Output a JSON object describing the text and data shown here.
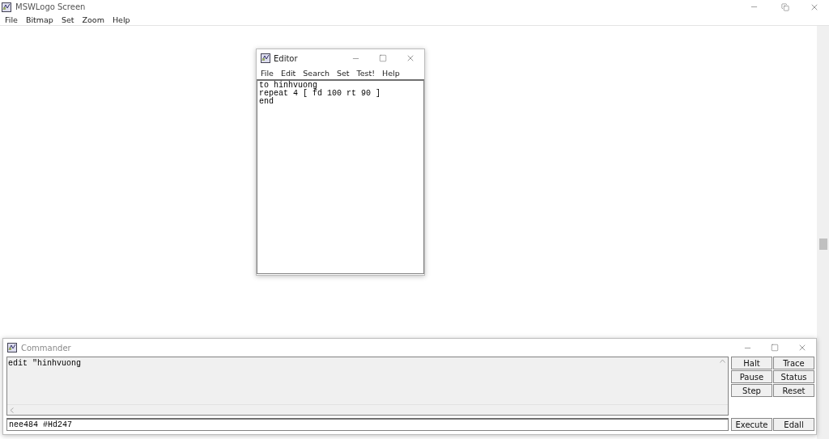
{
  "window": {
    "title": "MSWLogo Screen",
    "maximized": true
  },
  "menu": [
    "File",
    "Bitmap",
    "Set",
    "Zoom",
    "Help"
  ],
  "editor": {
    "title": "Editor",
    "menu": [
      "File",
      "Edit",
      "Search",
      "Set",
      "Test!",
      "Help"
    ],
    "lines": [
      "to hinhvuong",
      "repeat 4 [ fd 100 rt 90 ]",
      "end"
    ]
  },
  "commander": {
    "title": "Commander",
    "history": [
      "edit \"hinhvuong"
    ],
    "input": "nee484 #Hd247",
    "buttons": [
      "Halt",
      "Trace",
      "Pause",
      "Status",
      "Step",
      "Reset"
    ],
    "bottom_buttons": [
      "Execute",
      "Edall"
    ]
  }
}
